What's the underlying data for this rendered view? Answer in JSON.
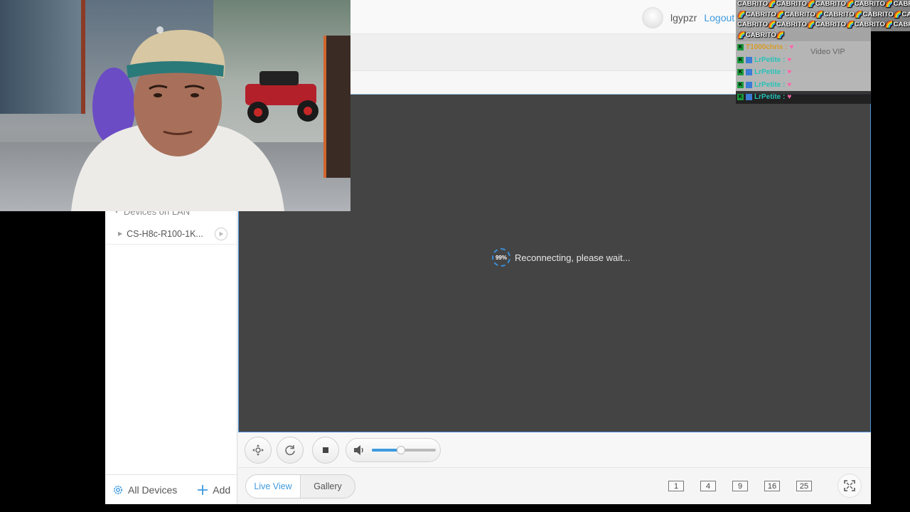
{
  "header": {
    "username": "lgypzr",
    "logout_label": "Logout",
    "video_vip_label": "Video VIP"
  },
  "sidebar": {
    "group_title": "Devices on LAN",
    "devices": [
      {
        "name": "CS-H8c-R100-1K..."
      }
    ],
    "all_devices_label": "All Devices",
    "add_label": "Add"
  },
  "video": {
    "progress_label": "99%",
    "progress": 0.99,
    "status_message": "Reconnecting, please wait..."
  },
  "controls": {
    "volume_level": 0.45
  },
  "bottombar": {
    "live_view_label": "Live View",
    "gallery_label": "Gallery",
    "layouts": [
      "1",
      "4",
      "9",
      "16",
      "25"
    ]
  },
  "chat": {
    "spam_lines": [
      "CABRITO🌈CABRITO🌈CABRITO🌈CABRITO🌈CABRITO🌈CABRIT",
      "🌈CABRITO🌈CABRITO🌈CABRITO🌈CABRITO🌈CABRITO🌈CAB",
      "CABRITO🌈CABRITO🌈CABRITO🌈CABRITO🌈CABRITO🌈CABRIT",
      "🌈CABRITO🌈"
    ],
    "messages": [
      {
        "user": "T1000chris :",
        "style": "1"
      },
      {
        "user": "LrPetite :",
        "style": "2"
      },
      {
        "user": "LrPetite :",
        "style": "2"
      },
      {
        "user": "LrPetite :",
        "style": "2"
      },
      {
        "user": "LrPetite :",
        "style": "2"
      }
    ]
  },
  "colors": {
    "accent": "#3e9ae0",
    "video_bg": "#444444",
    "border_blue": "#4a90d9"
  }
}
